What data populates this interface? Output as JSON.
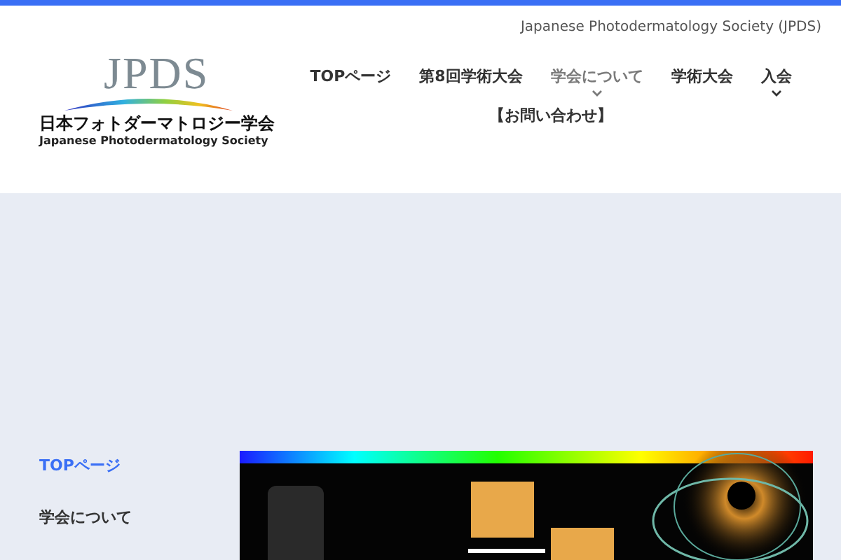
{
  "header": {
    "tagline": "Japanese Photodermatology Society (JPDS)"
  },
  "logo": {
    "mark": "JPDS",
    "name_ja": "日本フォトダーマトロジー学会",
    "name_en": "Japanese Photodermatology Society"
  },
  "nav": [
    {
      "label": "TOPページ",
      "dropdown": false,
      "highlighted": false
    },
    {
      "label": "第8回学術大会",
      "dropdown": false,
      "highlighted": false
    },
    {
      "label": "学会について",
      "dropdown": true,
      "highlighted": true
    },
    {
      "label": "学術大会",
      "dropdown": false,
      "highlighted": false
    },
    {
      "label": "入会",
      "dropdown": true,
      "highlighted": false
    },
    {
      "label": "【お問い合わせ】",
      "dropdown": false,
      "highlighted": false
    }
  ],
  "sidebar": {
    "items": [
      {
        "label": "TOPページ",
        "selected": true
      },
      {
        "label": "学会について",
        "selected": false
      }
    ]
  }
}
